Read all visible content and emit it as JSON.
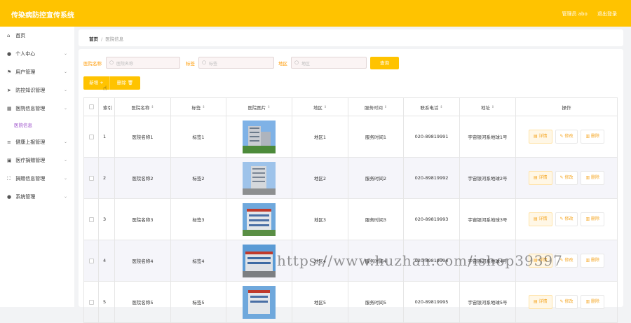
{
  "header": {
    "title": "传染病防控宣传系统",
    "role": "管理员 abo",
    "logout": "退出登录"
  },
  "sidebar": {
    "items": [
      {
        "icon": "home-icon",
        "glyph": "⌂",
        "label": "首页",
        "chevron": ""
      },
      {
        "icon": "user-icon",
        "glyph": "●",
        "label": "个人中心",
        "chevron": "⌄"
      },
      {
        "icon": "flag-icon",
        "glyph": "⚑",
        "label": "用户管理",
        "chevron": "⌄"
      },
      {
        "icon": "send-icon",
        "glyph": "➤",
        "label": "防控知识管理",
        "chevron": "⌄"
      },
      {
        "icon": "grid-icon",
        "glyph": "▦",
        "label": "医院信息管理",
        "chevron": "⌄"
      }
    ],
    "sub_item": "医院信息",
    "items2": [
      {
        "icon": "sliders-icon",
        "glyph": "≡",
        "label": "健康上报管理",
        "chevron": "⌄"
      },
      {
        "icon": "box-icon",
        "glyph": "▣",
        "label": "医疗捐赠管理",
        "chevron": "⌄"
      },
      {
        "icon": "expand-icon",
        "glyph": "⛶",
        "label": "捐赠信息管理",
        "chevron": "⌄"
      },
      {
        "icon": "location-icon",
        "glyph": "●",
        "label": "系统管理",
        "chevron": "⌄"
      }
    ]
  },
  "breadcrumb": {
    "home": "首页",
    "separator": "/",
    "current": "医院信息"
  },
  "search": {
    "name_label": "医院名称",
    "name_placeholder": "医院名称",
    "tag_label": "标签",
    "tag_placeholder": "标签",
    "area_label": "地区",
    "area_placeholder": "地区",
    "query_button": "查询",
    "search_glyph": "○"
  },
  "toolbar": {
    "add": "新增 +",
    "delete": "删除 🗑"
  },
  "table": {
    "headers": [
      "索引",
      "医院名称",
      "标签",
      "医院图片",
      "地区",
      "服务时间",
      "联系电话",
      "地址",
      "操作"
    ],
    "sort_glyph": "⇕",
    "rows": [
      {
        "index": "1",
        "name": "医院名称1",
        "tag": "标签1",
        "area": "地区1",
        "time": "服务时间1",
        "phone": "020-89819991",
        "address": "宇宙银河系地球1号"
      },
      {
        "index": "2",
        "name": "医院名称2",
        "tag": "标签2",
        "area": "地区2",
        "time": "服务时间2",
        "phone": "020-89819992",
        "address": "宇宙银河系地球2号"
      },
      {
        "index": "3",
        "name": "医院名称3",
        "tag": "标签3",
        "area": "地区3",
        "time": "服务时间3",
        "phone": "020-89819993",
        "address": "宇宙银河系地球3号"
      },
      {
        "index": "4",
        "name": "医院名称4",
        "tag": "标签4",
        "area": "地区4",
        "time": "服务时间4",
        "phone": "020-89819994",
        "address": "宇宙银河系地球4号"
      },
      {
        "index": "5",
        "name": "医院名称5",
        "tag": "标签5",
        "area": "地区5",
        "time": "服务时间5",
        "phone": "020-89819995",
        "address": "宇宙银河系地球5号"
      }
    ],
    "actions": {
      "detail": "▤ 详情",
      "edit": "✎ 修改",
      "delete": "▥ 删除"
    }
  },
  "watermark": "https://www.huzhan.com/ishop39397",
  "colors": {
    "accent": "#ffc300",
    "label": "#ff9900",
    "submenu": "#9b4dca"
  }
}
